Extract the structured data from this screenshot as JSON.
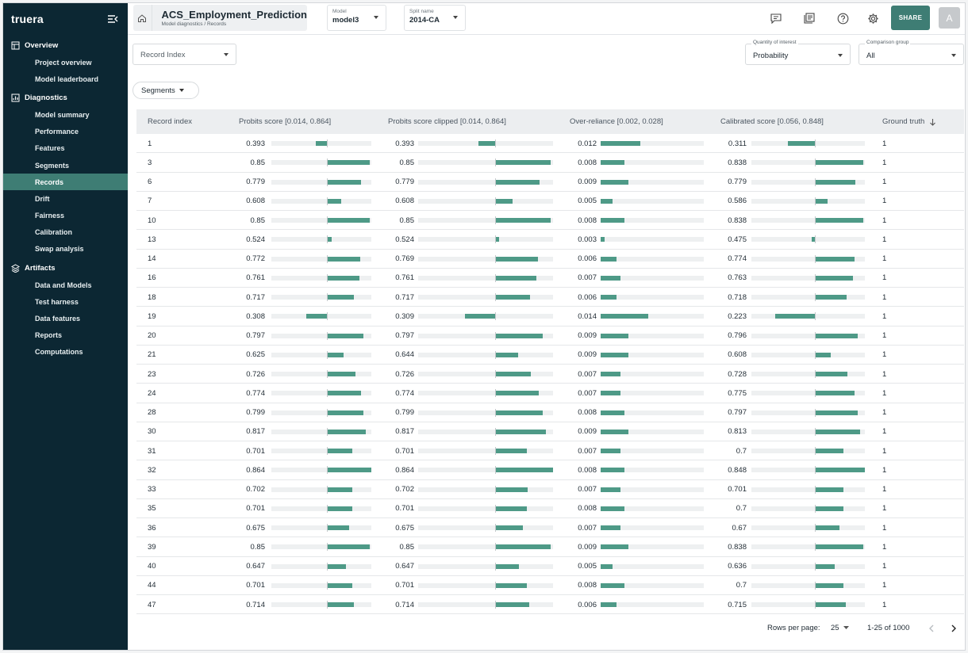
{
  "app": {
    "logo": "truera",
    "share_label": "SHARE",
    "avatar_initial": "A"
  },
  "colors": {
    "sidebar_bg": "#0c2733",
    "accent": "#3e7d74",
    "bar": "#4e9a87"
  },
  "sidebar": {
    "sections": [
      {
        "label": "Overview",
        "icon": "overview-icon",
        "items": [
          "Project overview",
          "Model leaderboard"
        ]
      },
      {
        "label": "Diagnostics",
        "icon": "diagnostics-icon",
        "items": [
          "Model summary",
          "Performance",
          "Features",
          "Segments",
          "Records",
          "Drift",
          "Fairness",
          "Calibration",
          "Swap analysis"
        ]
      },
      {
        "label": "Artifacts",
        "icon": "layers-icon",
        "items": [
          "Data and Models",
          "Test harness",
          "Data features",
          "Reports",
          "Computations"
        ]
      }
    ],
    "active_item": "Records"
  },
  "header": {
    "project_title": "ACS_Employment_Prediction",
    "breadcrumb": "Model diagnostics / Records",
    "model_label": "Model",
    "model_value": "model3",
    "split_label": "Split name",
    "split_value": "2014-CA"
  },
  "filters": {
    "record_index_placeholder": "Record Index",
    "qoi_label": "Quantity of interest",
    "qoi_value": "Probability",
    "comparison_label": "Comparison group",
    "comparison_value": "All",
    "segments_label": "Segments"
  },
  "table": {
    "columns": [
      "Record index",
      "Probits score [0.014, 0.864]",
      "Probits score clipped [0.014, 0.864]",
      "Over-reliance [0.002, 0.028]",
      "Calibrated score [0.056, 0.848]",
      "Ground truth"
    ],
    "rows": [
      [
        "1",
        "0.393",
        "0.393",
        "0.012",
        "0.311",
        "1"
      ],
      [
        "3",
        "0.85",
        "0.85",
        "0.008",
        "0.838",
        "1"
      ],
      [
        "6",
        "0.779",
        "0.779",
        "0.009",
        "0.779",
        "1"
      ],
      [
        "7",
        "0.608",
        "0.608",
        "0.005",
        "0.586",
        "1"
      ],
      [
        "10",
        "0.85",
        "0.85",
        "0.008",
        "0.838",
        "1"
      ],
      [
        "13",
        "0.524",
        "0.524",
        "0.003",
        "0.475",
        "1"
      ],
      [
        "14",
        "0.772",
        "0.769",
        "0.006",
        "0.774",
        "1"
      ],
      [
        "16",
        "0.761",
        "0.761",
        "0.007",
        "0.763",
        "1"
      ],
      [
        "18",
        "0.717",
        "0.717",
        "0.006",
        "0.718",
        "1"
      ],
      [
        "19",
        "0.308",
        "0.309",
        "0.014",
        "0.223",
        "1"
      ],
      [
        "20",
        "0.797",
        "0.797",
        "0.009",
        "0.796",
        "1"
      ],
      [
        "21",
        "0.625",
        "0.644",
        "0.009",
        "0.608",
        "1"
      ],
      [
        "23",
        "0.726",
        "0.726",
        "0.007",
        "0.728",
        "1"
      ],
      [
        "24",
        "0.774",
        "0.774",
        "0.007",
        "0.775",
        "1"
      ],
      [
        "28",
        "0.799",
        "0.799",
        "0.008",
        "0.797",
        "1"
      ],
      [
        "30",
        "0.817",
        "0.817",
        "0.009",
        "0.813",
        "1"
      ],
      [
        "31",
        "0.701",
        "0.701",
        "0.007",
        "0.7",
        "1"
      ],
      [
        "32",
        "0.864",
        "0.864",
        "0.008",
        "0.848",
        "1"
      ],
      [
        "33",
        "0.702",
        "0.702",
        "0.007",
        "0.701",
        "1"
      ],
      [
        "35",
        "0.701",
        "0.701",
        "0.008",
        "0.7",
        "1"
      ],
      [
        "36",
        "0.675",
        "0.675",
        "0.007",
        "0.67",
        "1"
      ],
      [
        "39",
        "0.85",
        "0.85",
        "0.009",
        "0.838",
        "1"
      ],
      [
        "40",
        "0.647",
        "0.647",
        "0.005",
        "0.636",
        "1"
      ],
      [
        "44",
        "0.701",
        "0.701",
        "0.008",
        "0.7",
        "1"
      ],
      [
        "47",
        "0.714",
        "0.714",
        "0.006",
        "0.715",
        "1"
      ]
    ]
  },
  "pagination": {
    "rows_per_page_label": "Rows per page:",
    "rows_per_page_value": "25",
    "range_text": "1-25 of 1000"
  }
}
